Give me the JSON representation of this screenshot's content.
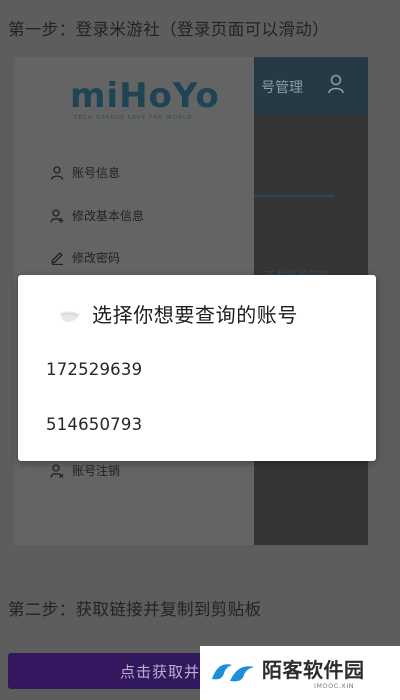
{
  "instructions": {
    "step1": "第一步：登录米游社（登录页面可以滑动）",
    "step2": "第二步：获取链接并复制到剪贴板"
  },
  "background_screen": {
    "logo_text": "miHoYo",
    "logo_tagline": "TECH OTAKUS SAVE THE WORLD",
    "header_title": "号管理",
    "header_icon": "user-icon",
    "panel_link": "查看账号信息",
    "menu_items": [
      {
        "icon": "user-icon",
        "label": "账号信息"
      },
      {
        "icon": "user-edit-icon",
        "label": "修改基本信息"
      },
      {
        "icon": "pencil-icon",
        "label": "修改密码"
      },
      {
        "icon": "user-remove-icon",
        "label": "账号注销"
      }
    ]
  },
  "dialog": {
    "title": "选择你想要查询的账号",
    "icon": "app-icon",
    "options": [
      "172529639",
      "514650793"
    ]
  },
  "action_button": {
    "label": "点击获取并"
  },
  "watermark": {
    "text": "陌客软件园",
    "url": "IMOOC.XIN"
  },
  "colors": {
    "overlay": "#5d5d5d",
    "header": "#253a44",
    "button": "#33185f",
    "logo": "#1f4454"
  }
}
